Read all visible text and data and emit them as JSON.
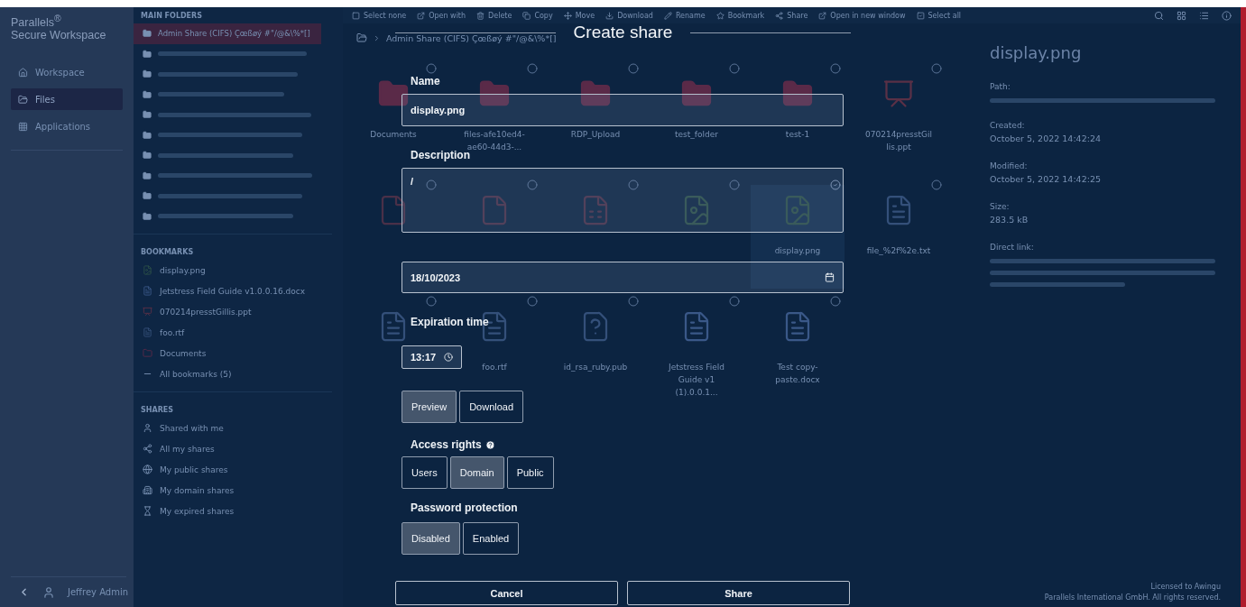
{
  "sidebar": {
    "logo": "Parallels$^{®}$",
    "subtitle": "Secure Workspace",
    "nav": [
      {
        "label": "Workspace",
        "selected": false
      },
      {
        "label": "Files",
        "selected": true
      },
      {
        "label": "Applications",
        "selected": false
      }
    ],
    "user": "Jeffrey Admin"
  },
  "folders": {
    "main_heading": "MAIN FOLDERS",
    "main": [
      {
        "label": "Admin Share (CIFS) Çœßøý #\"/@&\\%*[]",
        "selected": true
      },
      {
        "selected": false
      },
      {
        "selected": false
      },
      {
        "selected": false
      },
      {
        "selected": false
      },
      {
        "selected": false
      },
      {
        "selected": false
      },
      {
        "selected": false
      },
      {
        "selected": false
      },
      {
        "selected": false
      }
    ],
    "bookmarks_heading": "BOOKMARKS",
    "bookmarks": [
      {
        "label": "display.png",
        "kind": "png"
      },
      {
        "label": "Jetstress Field Guide v1.0.0.16.docx",
        "kind": "doc"
      },
      {
        "label": "070214presstGillis.ppt",
        "kind": "ppt"
      },
      {
        "label": "foo.rtf",
        "kind": "rtf"
      },
      {
        "label": "Documents",
        "kind": "folder"
      },
      {
        "label": "All bookmarks (5)",
        "kind": "more"
      }
    ],
    "shares_heading": "SHARES",
    "shares": [
      "Shared with me",
      "All my shares",
      "My public shares",
      "My domain shares",
      "My expired shares"
    ]
  },
  "toolbar": {
    "actions": [
      "Select none",
      "Open with",
      "Delete",
      "Copy",
      "Move",
      "Download",
      "Rename",
      "Bookmark",
      "Share",
      "Open in new window",
      "Select all"
    ]
  },
  "breadcrumb": "Admin Share (CIFS) Çœßøý #\"/@&\\%*[]",
  "files": [
    {
      "name": "Documents",
      "kind": "folder",
      "selected": false
    },
    {
      "name": "files-afe10ed4-ae60-44d3-...",
      "kind": "folder",
      "selected": false
    },
    {
      "name": "RDP_Upload",
      "kind": "folder",
      "selected": false
    },
    {
      "name": "test_folder",
      "kind": "folder",
      "selected": false
    },
    {
      "name": "test-1",
      "kind": "folder",
      "selected": false
    },
    {
      "name": "070214presstGillis.ppt",
      "kind": "ppt",
      "selected": false
    },
    {
      "kind": "pdf",
      "selected": false
    },
    {
      "kind": "pdf",
      "selected": false
    },
    {
      "kind": "csv",
      "selected": false
    },
    {
      "kind": "png",
      "selected": false
    },
    {
      "name": "display.png",
      "kind": "png",
      "selected": true
    },
    {
      "name": "file_%2f%2e.txt",
      "kind": "txt",
      "selected": false
    },
    {
      "kind": "rtf",
      "selected": false
    },
    {
      "name": "foo.rtf",
      "kind": "rtf",
      "selected": false
    },
    {
      "name": "id_rsa_ruby.pub",
      "kind": "unknown",
      "selected": false
    },
    {
      "name": "Jetstress Field Guide v1 (1).0.0.1...",
      "kind": "doc",
      "selected": false
    },
    {
      "name": "Test copy-paste.docx",
      "kind": "doc",
      "selected": false
    }
  ],
  "details": {
    "title": "display.png",
    "fields": [
      {
        "label": "Path:",
        "kind": "blurred_line"
      },
      {
        "label": "Created:",
        "kind": "text",
        "value": "October 5, 2022 14:42:24"
      },
      {
        "label": "Modified:",
        "kind": "text",
        "value": "October 5, 2022 14:42:25"
      },
      {
        "label": "Size:",
        "kind": "text",
        "value": "283.5 kB"
      },
      {
        "label": "Direct link:",
        "kind": "blurred_block"
      }
    ]
  },
  "dialog": {
    "title": "Create share",
    "name_label": "Name",
    "name_value": "display.png",
    "description_label": "Description",
    "description_value": "/",
    "date_value": "18/10/2023",
    "time_label": "Expiration time",
    "time_value": "13:17",
    "mode_options": [
      {
        "label": "Preview",
        "selected": true
      },
      {
        "label": "Download",
        "selected": false
      }
    ],
    "access_label": "Access rights",
    "access_options": [
      {
        "label": "Users",
        "selected": false
      },
      {
        "label": "Domain",
        "selected": true
      },
      {
        "label": "Public",
        "selected": false
      }
    ],
    "password_label": "Password protection",
    "password_options": [
      {
        "label": "Disabled",
        "selected": true
      },
      {
        "label": "Enabled",
        "selected": false
      }
    ],
    "cancel": "Cancel",
    "submit": "Share"
  },
  "footer": {
    "license": "Licensed to Awingu",
    "copyright": "Parallels International GmbH. All rights reserved."
  }
}
